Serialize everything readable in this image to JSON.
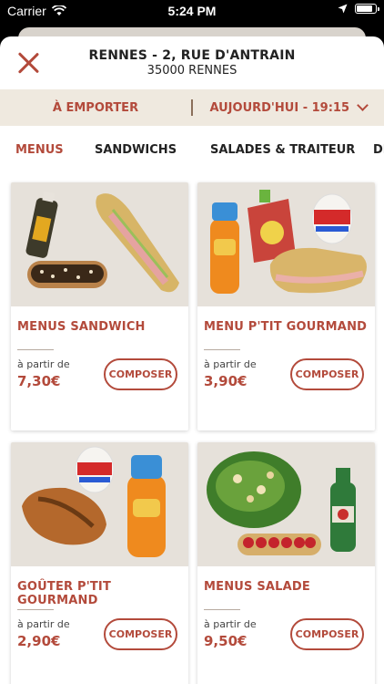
{
  "status_bar": {
    "carrier": "Carrier",
    "time": "5:24 PM",
    "battery_level": 0.9
  },
  "header": {
    "store_name": "RENNES - 2, RUE D'ANTRAIN",
    "store_city": "35000 RENNES"
  },
  "order_bar": {
    "mode": "À EMPORTER",
    "when": "AUJOURD'HUI - 19:15"
  },
  "tabs": [
    {
      "label": "MENUS",
      "active": true
    },
    {
      "label": "SANDWICHS",
      "active": false
    },
    {
      "label": "SALADES & TRAITEUR",
      "active": false
    },
    {
      "label": "DE",
      "active": false
    }
  ],
  "products": [
    {
      "title": "MENUS SANDWICH",
      "from_label": "à partir de",
      "price": "7,30€",
      "action": "COMPOSER",
      "items": [
        "juice-bottle-icon",
        "sandwich-icon",
        "eclair-icon"
      ]
    },
    {
      "title": "MENU P'TIT GOURMAND",
      "from_label": "à partir de",
      "price": "3,90€",
      "action": "COMPOSER",
      "items": [
        "oasis-bottle-icon",
        "fruit-pouch-icon",
        "kinder-egg-icon",
        "sandwich-icon"
      ]
    },
    {
      "title": "GOÛTER P'TIT GOURMAND",
      "from_label": "à partir de",
      "price": "2,90€",
      "action": "COMPOSER",
      "items": [
        "kinder-egg-icon",
        "pain-au-chocolat-icon",
        "oasis-bottle-icon"
      ]
    },
    {
      "title": "MENUS SALADE",
      "from_label": "à partir de",
      "price": "9,50€",
      "action": "COMPOSER",
      "items": [
        "salad-bowl-icon",
        "water-bottle-icon",
        "raspberry-tart-icon"
      ]
    }
  ],
  "colors": {
    "accent": "#b34a3b",
    "bar_bg": "#efe9df"
  }
}
